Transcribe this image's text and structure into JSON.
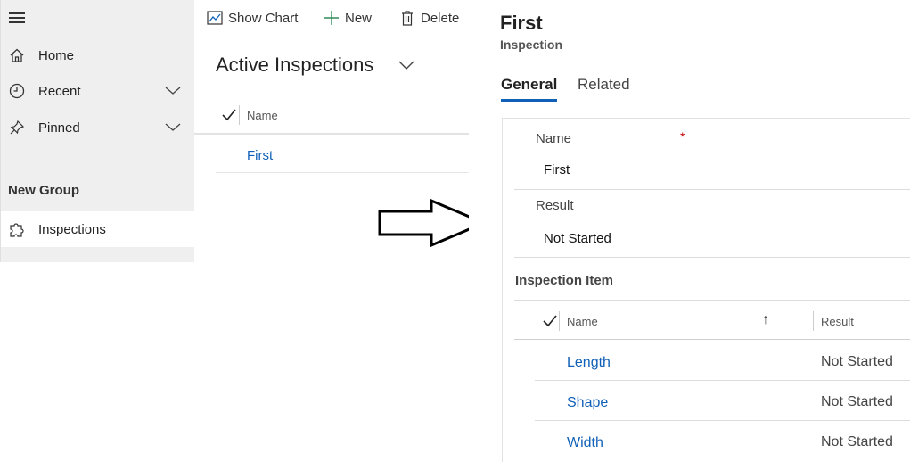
{
  "sidebar": {
    "items": [
      {
        "label": "Home",
        "icon": "home-icon"
      },
      {
        "label": "Recent",
        "icon": "clock-icon"
      },
      {
        "label": "Pinned",
        "icon": "pin-icon"
      }
    ],
    "group_label": "New Group",
    "entity": {
      "label": "Inspections",
      "icon": "puzzle-icon"
    }
  },
  "commandbar": {
    "show_chart": "Show Chart",
    "new": "New",
    "delete": "Delete"
  },
  "list": {
    "view_title": "Active Inspections",
    "column_name": "Name",
    "rows": [
      "First"
    ]
  },
  "form": {
    "title": "First",
    "subtitle": "Inspection",
    "tabs": [
      "General",
      "Related"
    ],
    "fields": {
      "name_label": "Name",
      "required_marker": "*",
      "name_value": "First",
      "result_label": "Result",
      "result_value": "Not Started"
    },
    "subgrid": {
      "title": "Inspection Item",
      "col_name": "Name",
      "col_result": "Result",
      "sort_icon": "↑",
      "rows": [
        {
          "name": "Length",
          "result": "Not Started"
        },
        {
          "name": "Shape",
          "result": "Not Started"
        },
        {
          "name": "Width",
          "result": "Not Started"
        }
      ]
    }
  },
  "colors": {
    "link": "#1160b7",
    "sidebar_bg": "#efefef",
    "required": "#c00000"
  }
}
